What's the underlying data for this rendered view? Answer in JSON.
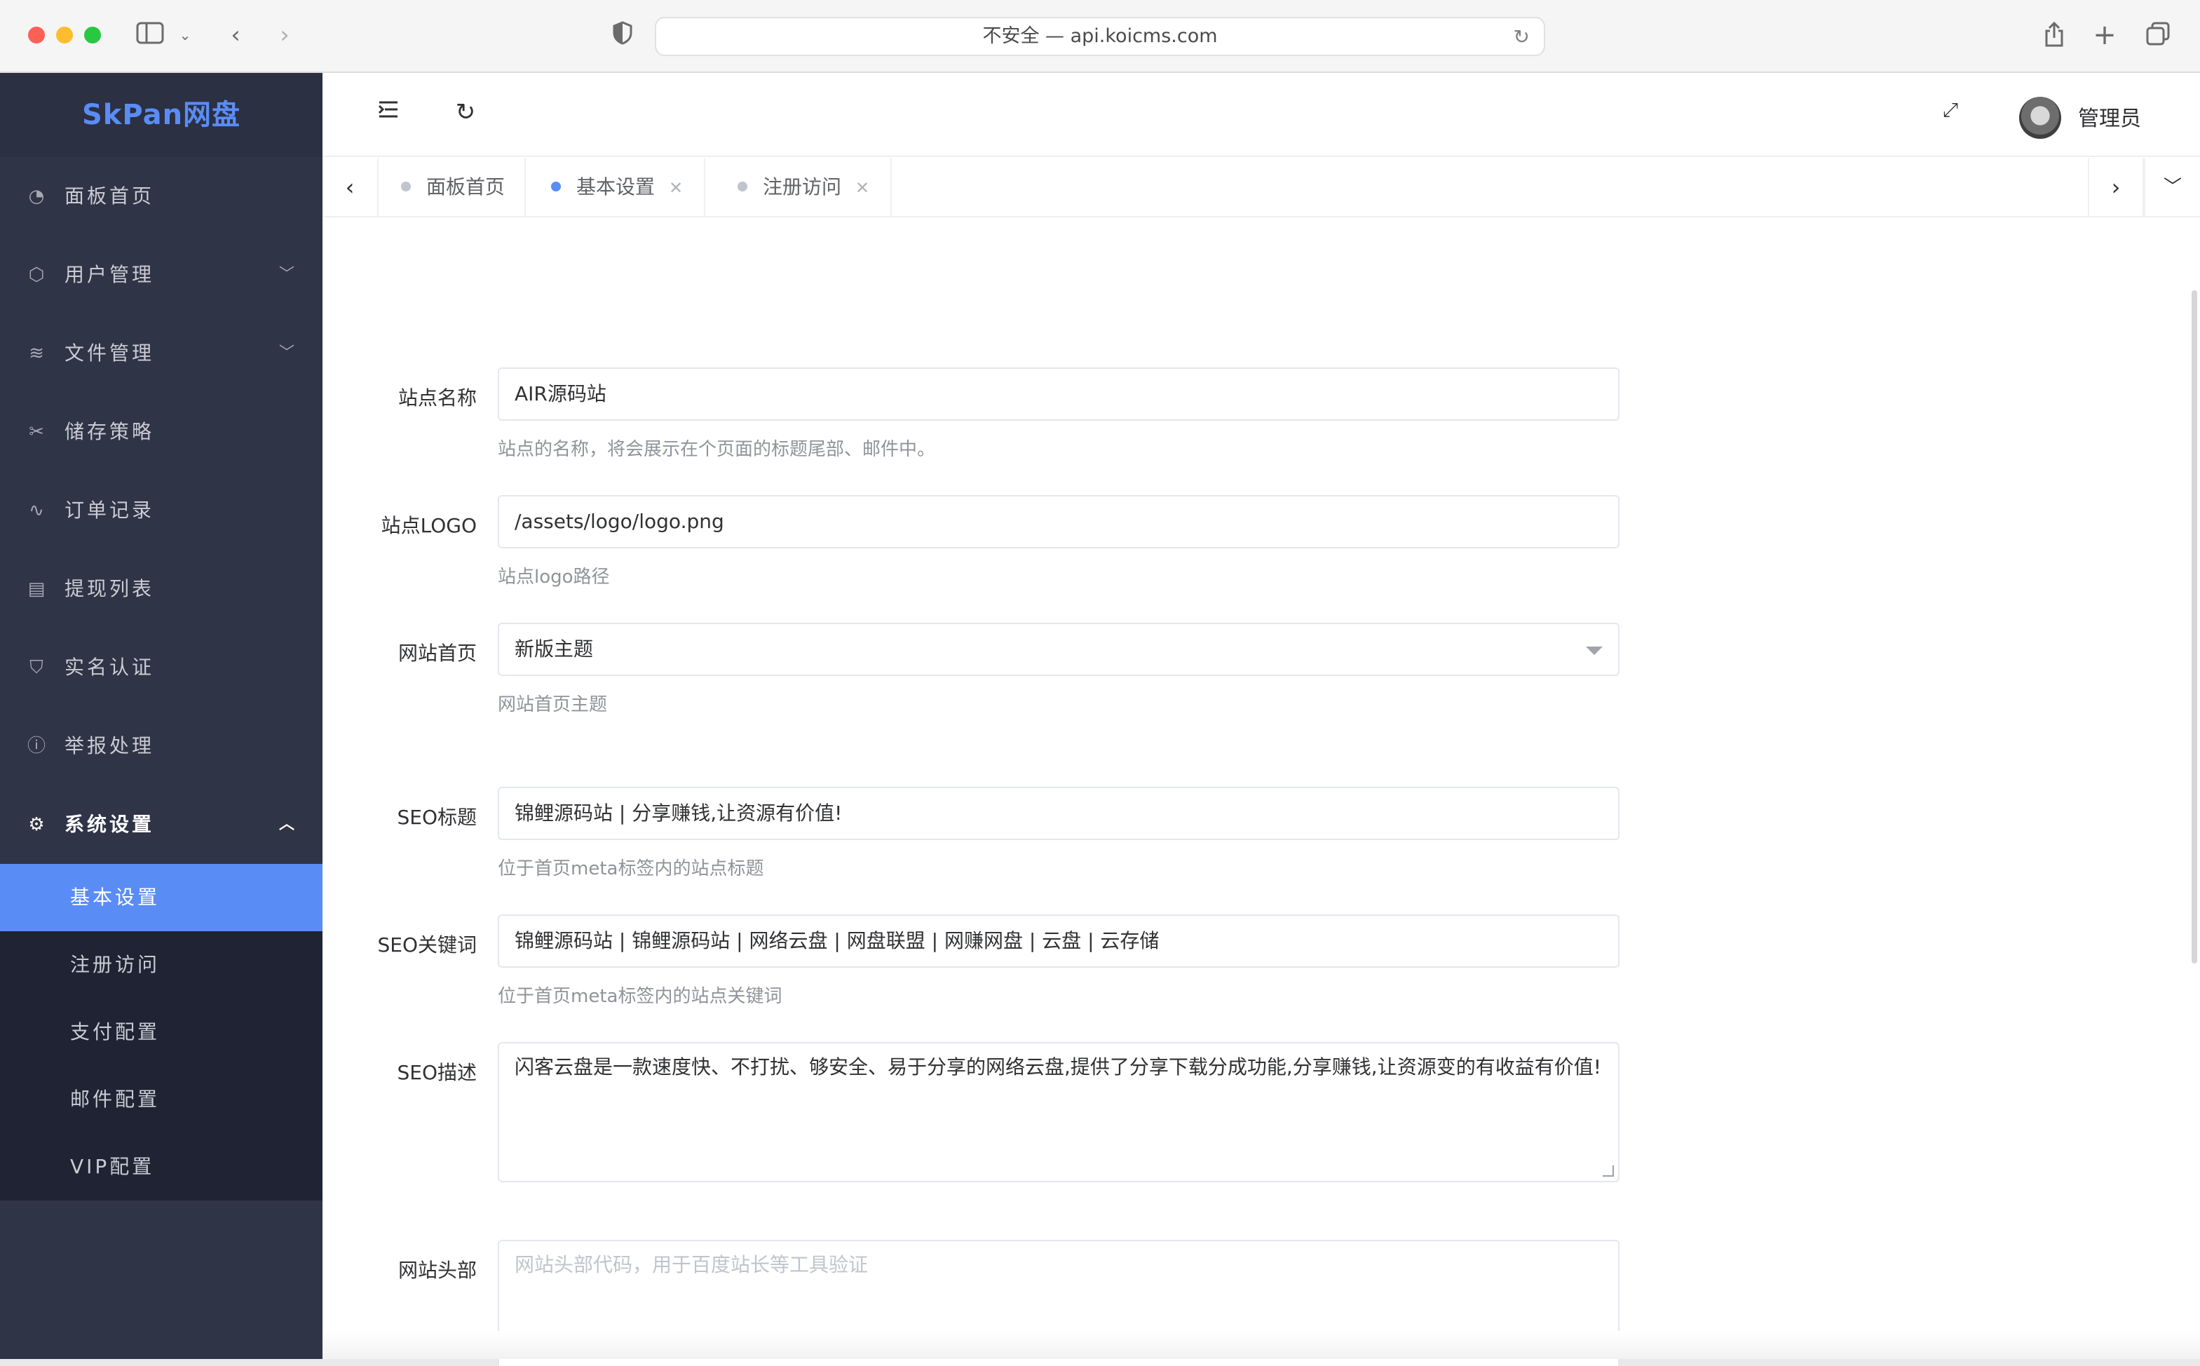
{
  "browser": {
    "url_text": "不安全 — api.koicms.com"
  },
  "sidebar": {
    "brand": "SkPan网盘",
    "items": [
      {
        "label": "面板首页",
        "icon": "dashboard-icon"
      },
      {
        "label": "用户管理",
        "icon": "cube-icon"
      },
      {
        "label": "文件管理",
        "icon": "layers-icon"
      },
      {
        "label": "储存策略",
        "icon": "tools-icon"
      },
      {
        "label": "订单记录",
        "icon": "pulse-icon"
      },
      {
        "label": "提现列表",
        "icon": "clipboard-icon"
      },
      {
        "label": "实名认证",
        "icon": "shield-icon"
      },
      {
        "label": "举报处理",
        "icon": "info-icon"
      },
      {
        "label": "系统设置",
        "icon": "gear-icon"
      }
    ],
    "subitems": [
      {
        "label": "基本设置"
      },
      {
        "label": "注册访问"
      },
      {
        "label": "支付配置"
      },
      {
        "label": "邮件配置"
      },
      {
        "label": "VIP配置"
      }
    ]
  },
  "header": {
    "username": "管理员"
  },
  "tabs": [
    {
      "label": "面板首页"
    },
    {
      "label": "基本设置"
    },
    {
      "label": "注册访问"
    }
  ],
  "form": {
    "site_name": {
      "label": "站点名称",
      "value": "AIR源码站",
      "help": "站点的名称，将会展示在个页面的标题尾部、邮件中。"
    },
    "site_logo": {
      "label": "站点LOGO",
      "value": "/assets/logo/logo.png",
      "help": "站点logo路径"
    },
    "homepage": {
      "label": "网站首页",
      "value": "新版主题",
      "help": "网站首页主题"
    },
    "seo_title": {
      "label": "SEO标题",
      "value": "锦鲤源码站 | 分享赚钱,让资源有价值!",
      "help": "位于首页meta标签内的站点标题"
    },
    "seo_keywords": {
      "label": "SEO关键词",
      "value": "锦鲤源码站 | 锦鲤源码站 | 网络云盘 | 网盘联盟 | 网赚网盘 | 云盘 | 云存储",
      "help": "位于首页meta标签内的站点关键词"
    },
    "seo_description": {
      "label": "SEO描述",
      "value": "闪客云盘是一款速度快、不打扰、够安全、易于分享的网络云盘,提供了分享下载分成功能,分享赚钱,让资源变的有收益有价值!"
    },
    "site_header": {
      "label": "网站头部",
      "placeholder": "网站头部代码，用于百度站长等工具验证"
    }
  },
  "colors": {
    "accent": "#5a8cf5",
    "sidebar_bg": "#2f3446",
    "submenu_bg": "#1f2333"
  }
}
